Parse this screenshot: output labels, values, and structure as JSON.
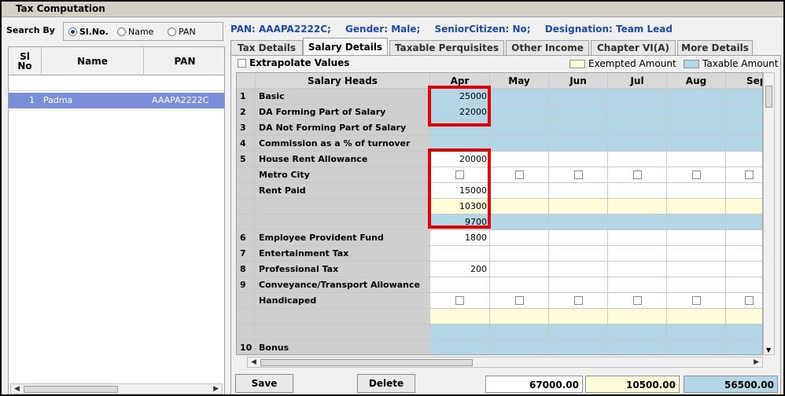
{
  "window": {
    "title": "Tax Computation"
  },
  "search": {
    "label": "Search By",
    "options": [
      {
        "label": "Sl.No.",
        "selected": true
      },
      {
        "label": "Name",
        "selected": false
      },
      {
        "label": "PAN",
        "selected": false
      }
    ]
  },
  "left_grid": {
    "columns": [
      "Sl\nNo",
      "Name",
      "PAN"
    ],
    "rows": [
      {
        "sl": "1",
        "name": "Padma",
        "pan": "AAAPA2222C"
      }
    ]
  },
  "employee_info": {
    "pan": "PAN: AAAPA2222C;",
    "gender": "Gender: Male;",
    "senior": "SeniorCitizen: No;",
    "designation": "Designation: Team Lead"
  },
  "tabs": [
    {
      "label": "Tax Details",
      "active": false
    },
    {
      "label": "Salary Details",
      "active": true
    },
    {
      "label": "Taxable Perquisites",
      "active": false
    },
    {
      "label": "Other Income",
      "active": false
    },
    {
      "label": "Chapter VI(A)",
      "active": false
    },
    {
      "label": "More Details",
      "active": false
    }
  ],
  "panel": {
    "extrapolate_label": "Extrapolate Values",
    "legend_exempted": "Exempted Amount",
    "legend_taxable": "Taxable Amount",
    "color_exempted": "#fffcd9",
    "color_taxable": "#b3d7e6"
  },
  "salary_grid": {
    "head_label": "Salary Heads",
    "months": [
      "Apr",
      "May",
      "Jun",
      "Jul",
      "Aug",
      "Sep"
    ],
    "rows": [
      {
        "no": "1",
        "head": "Basic",
        "apr": "25000",
        "type": "blue"
      },
      {
        "no": "2",
        "head": "DA Forming Part of Salary",
        "apr": "22000",
        "type": "blue"
      },
      {
        "no": "3",
        "head": "DA Not Forming Part of Salary",
        "apr": "",
        "type": "blue"
      },
      {
        "no": "4",
        "head": "Commission as a % of turnover",
        "apr": "",
        "type": "blue"
      },
      {
        "no": "5",
        "head": "House Rent Allowance",
        "apr": "20000",
        "type": "white"
      },
      {
        "no": "",
        "head": "Metro City",
        "apr": "",
        "type": "check"
      },
      {
        "no": "",
        "head": "Rent Paid",
        "apr": "15000",
        "type": "white"
      },
      {
        "no": "",
        "head": "",
        "apr": "10300",
        "type": "yel"
      },
      {
        "no": "",
        "head": "",
        "apr": "9700",
        "type": "blue"
      },
      {
        "no": "6",
        "head": "Employee Provident Fund",
        "apr": "1800",
        "type": "white"
      },
      {
        "no": "7",
        "head": "Entertainment Tax",
        "apr": "",
        "type": "white"
      },
      {
        "no": "8",
        "head": "Professional Tax",
        "apr": "200",
        "type": "white"
      },
      {
        "no": "9",
        "head": "Conveyance/Transport Allowance",
        "apr": "",
        "type": "white"
      },
      {
        "no": "",
        "head": "Handicaped",
        "apr": "",
        "type": "check"
      },
      {
        "no": "",
        "head": "",
        "apr": "",
        "type": "yel"
      },
      {
        "no": "",
        "head": "",
        "apr": "",
        "type": "blue"
      },
      {
        "no": "10",
        "head": "Bonus",
        "apr": "",
        "type": "blue"
      }
    ]
  },
  "buttons": {
    "save": "Save",
    "delete": "Delete"
  },
  "totals": {
    "total": "67000.00",
    "exempted": "10500.00",
    "taxable": "56500.00"
  }
}
